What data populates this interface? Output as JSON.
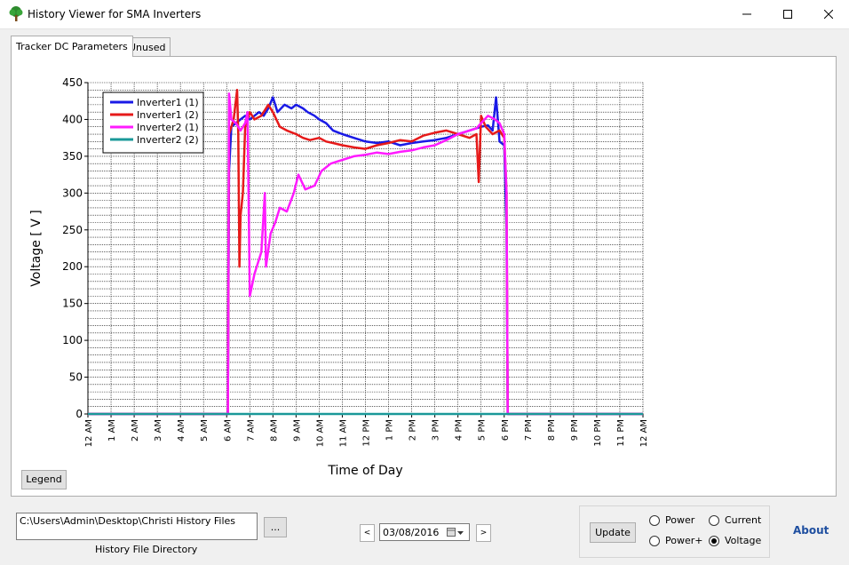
{
  "window": {
    "title": "History Viewer for SMA Inverters"
  },
  "tabs": [
    {
      "label": "Tracker DC Parameters",
      "active": true
    },
    {
      "label": "Unused",
      "active": false
    }
  ],
  "chart_data": {
    "type": "line",
    "xlabel": "Time of Day",
    "ylabel": "Voltage [ V ]",
    "ylim": [
      0,
      450
    ],
    "yticks": [
      0,
      50,
      100,
      150,
      200,
      250,
      300,
      350,
      400,
      450
    ],
    "xlim": [
      0,
      24
    ],
    "xticks": [
      "12 AM",
      "1 AM",
      "2 AM",
      "3 AM",
      "4 AM",
      "5 AM",
      "6 AM",
      "7 AM",
      "8 AM",
      "9 AM",
      "10 AM",
      "11 AM",
      "12 PM",
      "1 PM",
      "2 PM",
      "3 PM",
      "4 PM",
      "5 PM",
      "6 PM",
      "7 PM",
      "8 PM",
      "9 PM",
      "10 PM",
      "11 PM",
      "12 AM"
    ],
    "grid": true,
    "legend_position": "top-left",
    "series": [
      {
        "name": "Inverter1 (1)",
        "color": "#1a1ae6",
        "points": [
          [
            0,
            0
          ],
          [
            6.0,
            0
          ],
          [
            6.05,
            0
          ],
          [
            6.1,
            330
          ],
          [
            6.2,
            390
          ],
          [
            6.4,
            395
          ],
          [
            6.6,
            400
          ],
          [
            6.8,
            405
          ],
          [
            7.0,
            400
          ],
          [
            7.2,
            405
          ],
          [
            7.4,
            410
          ],
          [
            7.6,
            405
          ],
          [
            7.8,
            415
          ],
          [
            8.0,
            430
          ],
          [
            8.2,
            410
          ],
          [
            8.5,
            420
          ],
          [
            8.8,
            415
          ],
          [
            9.0,
            420
          ],
          [
            9.3,
            415
          ],
          [
            9.5,
            410
          ],
          [
            9.8,
            405
          ],
          [
            10.0,
            400
          ],
          [
            10.3,
            395
          ],
          [
            10.6,
            385
          ],
          [
            11.0,
            380
          ],
          [
            11.5,
            375
          ],
          [
            12.0,
            370
          ],
          [
            12.5,
            368
          ],
          [
            13.0,
            370
          ],
          [
            13.5,
            365
          ],
          [
            14.0,
            368
          ],
          [
            14.5,
            370
          ],
          [
            15.0,
            372
          ],
          [
            15.5,
            375
          ],
          [
            16.0,
            380
          ],
          [
            16.5,
            385
          ],
          [
            17.0,
            390
          ],
          [
            17.3,
            392
          ],
          [
            17.5,
            385
          ],
          [
            17.65,
            430
          ],
          [
            17.8,
            370
          ],
          [
            18.0,
            365
          ],
          [
            18.1,
            250
          ],
          [
            18.15,
            0
          ],
          [
            24,
            0
          ]
        ]
      },
      {
        "name": "Inverter1 (2)",
        "color": "#e61a1a",
        "points": [
          [
            0,
            0
          ],
          [
            6.0,
            0
          ],
          [
            6.05,
            0
          ],
          [
            6.1,
            380
          ],
          [
            6.3,
            400
          ],
          [
            6.45,
            440
          ],
          [
            6.5,
            380
          ],
          [
            6.55,
            200
          ],
          [
            6.6,
            270
          ],
          [
            6.7,
            300
          ],
          [
            6.8,
            390
          ],
          [
            7.0,
            410
          ],
          [
            7.2,
            400
          ],
          [
            7.5,
            405
          ],
          [
            7.8,
            420
          ],
          [
            8.0,
            410
          ],
          [
            8.3,
            390
          ],
          [
            8.6,
            385
          ],
          [
            9.0,
            380
          ],
          [
            9.3,
            375
          ],
          [
            9.6,
            372
          ],
          [
            10.0,
            375
          ],
          [
            10.3,
            370
          ],
          [
            10.6,
            368
          ],
          [
            11.0,
            365
          ],
          [
            11.5,
            362
          ],
          [
            12.0,
            360
          ],
          [
            12.5,
            365
          ],
          [
            13.0,
            368
          ],
          [
            13.5,
            372
          ],
          [
            14.0,
            370
          ],
          [
            14.5,
            378
          ],
          [
            15.0,
            382
          ],
          [
            15.5,
            385
          ],
          [
            16.0,
            380
          ],
          [
            16.5,
            375
          ],
          [
            16.8,
            380
          ],
          [
            16.9,
            315
          ],
          [
            17.0,
            405
          ],
          [
            17.2,
            390
          ],
          [
            17.5,
            380
          ],
          [
            17.8,
            385
          ],
          [
            18.0,
            375
          ],
          [
            18.1,
            300
          ],
          [
            18.15,
            0
          ],
          [
            24,
            0
          ]
        ]
      },
      {
        "name": "Inverter2 (1)",
        "color": "#ff1aff",
        "points": [
          [
            0,
            0
          ],
          [
            6.0,
            0
          ],
          [
            6.05,
            0
          ],
          [
            6.1,
            435
          ],
          [
            6.2,
            400
          ],
          [
            6.4,
            395
          ],
          [
            6.6,
            385
          ],
          [
            6.8,
            395
          ],
          [
            6.9,
            410
          ],
          [
            7.0,
            160
          ],
          [
            7.2,
            190
          ],
          [
            7.5,
            220
          ],
          [
            7.65,
            300
          ],
          [
            7.7,
            200
          ],
          [
            7.9,
            245
          ],
          [
            8.1,
            260
          ],
          [
            8.3,
            280
          ],
          [
            8.6,
            275
          ],
          [
            8.9,
            300
          ],
          [
            9.1,
            325
          ],
          [
            9.4,
            305
          ],
          [
            9.8,
            310
          ],
          [
            10.1,
            330
          ],
          [
            10.5,
            340
          ],
          [
            11.0,
            345
          ],
          [
            11.5,
            350
          ],
          [
            12.0,
            352
          ],
          [
            12.5,
            355
          ],
          [
            13.0,
            353
          ],
          [
            13.5,
            356
          ],
          [
            14.0,
            358
          ],
          [
            14.5,
            362
          ],
          [
            15.0,
            365
          ],
          [
            15.5,
            372
          ],
          [
            16.0,
            380
          ],
          [
            16.5,
            385
          ],
          [
            16.8,
            388
          ],
          [
            17.0,
            395
          ],
          [
            17.3,
            405
          ],
          [
            17.6,
            400
          ],
          [
            17.8,
            395
          ],
          [
            18.0,
            380
          ],
          [
            18.1,
            300
          ],
          [
            18.15,
            0
          ],
          [
            24,
            0
          ]
        ]
      },
      {
        "name": "Inverter2 (2)",
        "color": "#1a9999",
        "points": [
          [
            0,
            0
          ],
          [
            24,
            0
          ]
        ]
      }
    ]
  },
  "buttons": {
    "legend": "Legend",
    "browse": "...",
    "update": "Update",
    "prev": "<",
    "next": ">"
  },
  "history": {
    "path_value": "C:\\Users\\Admin\\Desktop\\Christi History Files",
    "label": "History File Directory"
  },
  "date": {
    "value": "03/08/2016"
  },
  "radios": [
    {
      "label": "Power",
      "checked": false
    },
    {
      "label": "Current",
      "checked": false
    },
    {
      "label": "Power+",
      "checked": false
    },
    {
      "label": "Voltage",
      "checked": true
    }
  ],
  "about": "About"
}
